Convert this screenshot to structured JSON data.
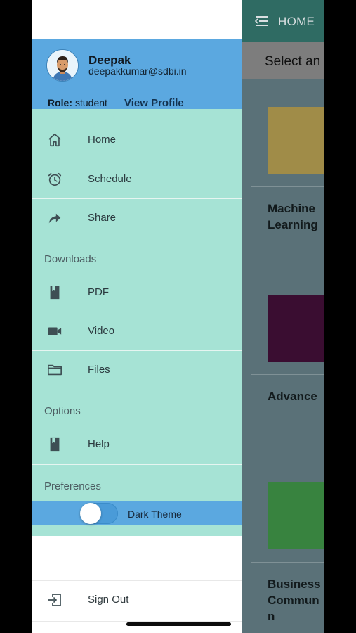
{
  "background": {
    "header_title": "HOME",
    "select_text": "Select an",
    "cards": [
      {
        "title": "Machine\nLearning",
        "color": "#a08c48"
      },
      {
        "title": "Advance",
        "color": "#3a0d31"
      },
      {
        "title": "Business\nCommun\nn",
        "color": "#38833f"
      }
    ]
  },
  "profile": {
    "name": "Deepak",
    "email": "deepakkumar@sdbi.in",
    "role_label": "Role:",
    "role_value": "student",
    "view_profile": "View Profile"
  },
  "menu": {
    "home": "Home",
    "schedule": "Schedule",
    "share": "Share",
    "downloads_header": "Downloads",
    "pdf": "PDF",
    "video": "Video",
    "files": "Files",
    "options_header": "Options",
    "help": "Help",
    "preferences_header": "Preferences",
    "dark_theme": "Dark Theme"
  },
  "dark_theme_enabled": false,
  "sign_out": "Sign Out",
  "colors": {
    "profile_bg": "#5ba8e0",
    "menu_bg": "#a6e3d5",
    "header_bg": "#2f6b63"
  }
}
